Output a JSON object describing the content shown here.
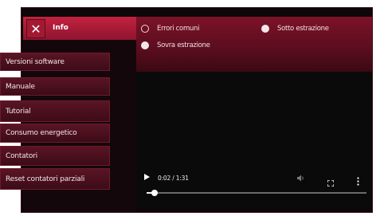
{
  "header": {
    "title": "Info",
    "close_glyph": "✕"
  },
  "sidebar": {
    "items": [
      {
        "label": "Versioni software"
      },
      {
        "label": "Manuale"
      },
      {
        "label": "Tutorial"
      },
      {
        "label": "Consumo energetico"
      },
      {
        "label": "Contatori"
      },
      {
        "label": "Reset contatori parziali"
      }
    ]
  },
  "options": {
    "items": [
      {
        "label": "Errori comuni",
        "selected": false
      },
      {
        "label": "Sotto estrazione",
        "selected": true
      },
      {
        "label": "Sovra estrazione",
        "selected": true
      }
    ]
  },
  "player": {
    "time": "0:02 / 1:31",
    "progress": 0.02
  },
  "colors": {
    "accent": "#c3213f",
    "sidebar_item": "#4a1020",
    "background": "#0d0709"
  },
  "icons": {
    "close": "close-icon",
    "play": "play-icon",
    "volume": "volume-icon",
    "fullscreen": "fullscreen-icon",
    "more": "more-vertical-icon"
  }
}
